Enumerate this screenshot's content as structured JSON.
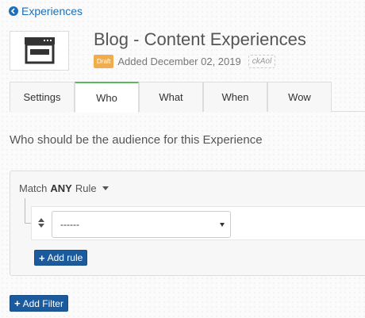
{
  "nav": {
    "back_label": "Experiences"
  },
  "header": {
    "title": "Blog - Content Experiences",
    "status_badge": "Draft",
    "added_text": "Added December 02, 2019",
    "code": "ckAol"
  },
  "tabs": [
    {
      "label": "Settings",
      "active": false
    },
    {
      "label": "Who",
      "active": true
    },
    {
      "label": "What",
      "active": false
    },
    {
      "label": "When",
      "active": false
    },
    {
      "label": "Wow",
      "active": false
    }
  ],
  "audience": {
    "prompt": "Who should be the audience for this Experience",
    "match_prefix": "Match",
    "match_mode": "ANY",
    "match_suffix": "Rule",
    "rule_select_value": "------",
    "add_rule_label": "Add rule"
  },
  "add_filter_label": "Add Filter",
  "colors": {
    "link": "#1d6fb8",
    "primary_button": "#1c5a9e",
    "active_tab_border": "#5cb85c",
    "draft_badge": "#f0ad4e"
  }
}
